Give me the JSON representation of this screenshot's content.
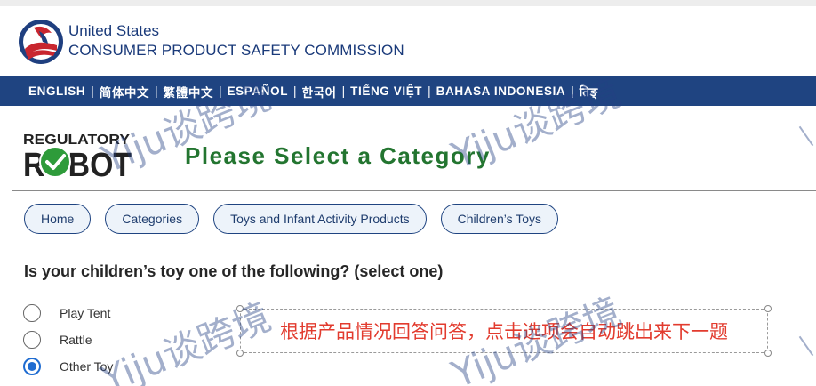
{
  "header": {
    "agency_line1": "United States",
    "agency_line2": "CONSUMER PRODUCT SAFETY COMMISSION"
  },
  "languages": [
    "ENGLISH",
    "简体中文",
    "繁體中文",
    "ESPAÑOL",
    "한국어",
    "TIẾNG VIỆT",
    "BAHASA INDONESIA",
    "तिङ्"
  ],
  "robot_logo": {
    "line1": "REGULATORY",
    "line2": "ROBOT"
  },
  "page": {
    "title": "Please Select a Category"
  },
  "breadcrumb": [
    "Home",
    "Categories",
    "Toys and Infant Activity Products",
    "Children’s Toys"
  ],
  "question": "Is your children’s toy one of the following? (select one)",
  "options": [
    {
      "label": "Play Tent",
      "checked": false
    },
    {
      "label": "Rattle",
      "checked": false
    },
    {
      "label": "Other Toy",
      "checked": true
    }
  ],
  "annotation": "根据产品情况回答问答，点击选项会自动跳出来下一题",
  "watermark": "Yiju谈跨境",
  "colors": {
    "nav_bar": "#1f4481",
    "title_green": "#237530",
    "radio_selected": "#1f6cd1",
    "annotation_red": "#e23b2e"
  }
}
